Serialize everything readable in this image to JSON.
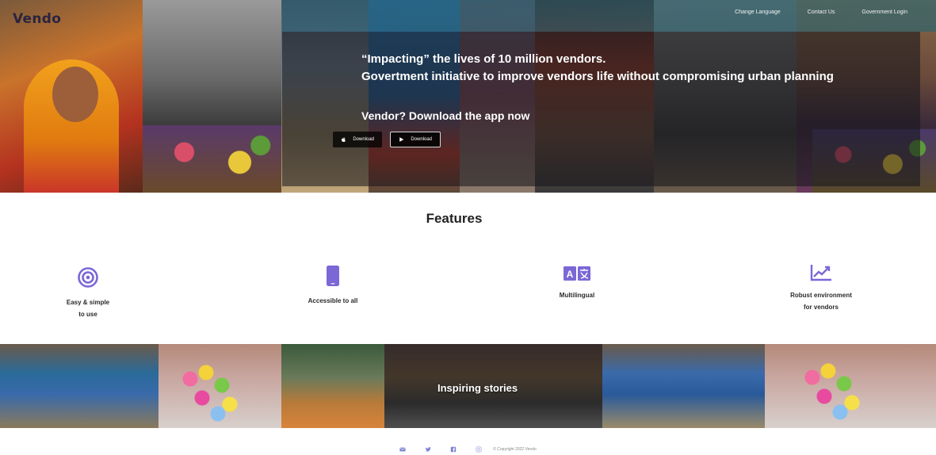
{
  "app": {
    "brand": "Vendo"
  },
  "nav": {
    "items": [
      {
        "label": "Change Language"
      },
      {
        "label": "Contact Us"
      },
      {
        "label": "Government Login"
      }
    ]
  },
  "hero": {
    "line1": "“Impacting” the lives of 10 million vendors.",
    "line2": "Govertment initiative to improve vendors life without compromising urban planning",
    "cta": "Vendor? Download the app now",
    "buttons": {
      "apple": "Download",
      "play": "Download"
    }
  },
  "features": {
    "title": "Features",
    "items": [
      {
        "label": "Easy & simple\nto use",
        "icon": "target-icon"
      },
      {
        "label": "Accessible to all",
        "icon": "smartphone-icon"
      },
      {
        "label": "Multilingual",
        "icon": "translate-icon"
      },
      {
        "label": "Robust environment\nfor vendors",
        "icon": "trending-up-icon"
      }
    ],
    "accent": "#7c67d6"
  },
  "stories": {
    "title": "Inspiring stories"
  },
  "footer": {
    "icons": [
      "mail-icon",
      "twitter-icon",
      "facebook-icon",
      "instagram-icon"
    ],
    "copyright": "© Copyright 2022 Vendo",
    "icon_color": "#7c84d0"
  }
}
